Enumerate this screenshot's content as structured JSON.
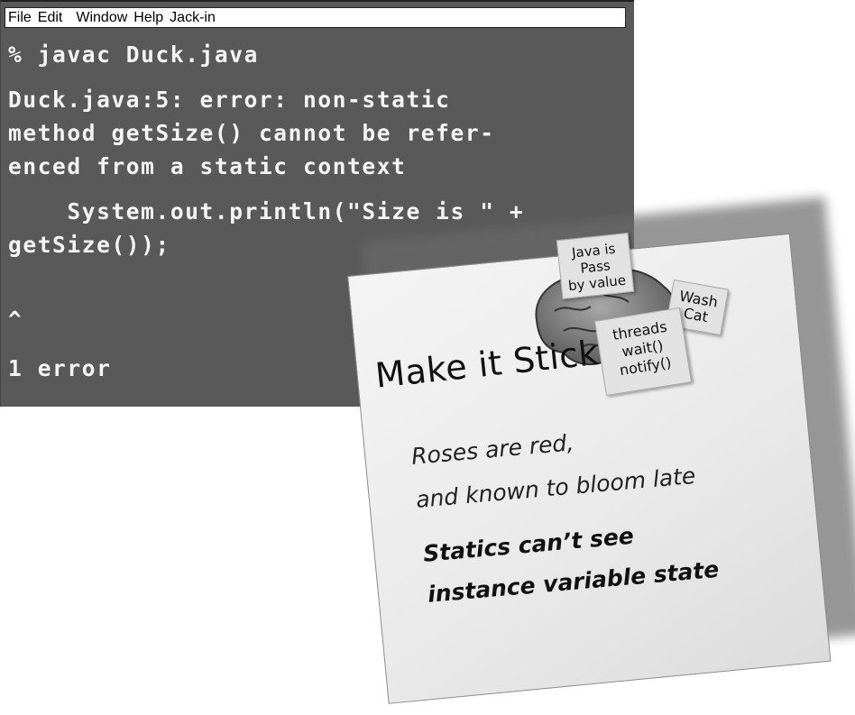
{
  "window": {
    "menu": [
      "File",
      "Edit",
      "Window",
      "Help",
      "Jack-in"
    ],
    "colors": {
      "background": "#595959",
      "text": "#f4f4f4",
      "menubar": "#ffffff"
    }
  },
  "terminal": {
    "command": "% javac Duck.java",
    "error_lines": [
      "Duck.java:5: error: non-static",
      "method getSize() cannot be refer-",
      "enced from a static context"
    ],
    "code_lines": [
      "    System.out.println(\"Size is \" +",
      "getSize());"
    ],
    "caret": "^",
    "summary": "1 error"
  },
  "sticky_note": {
    "title": "Make it Stick",
    "tags": [
      {
        "text": "Java is\nPass\nby value"
      },
      {
        "text": "Wash\nCat"
      },
      {
        "text": "threads\nwait()\nnotify()"
      }
    ],
    "lines": [
      "Roses are red,",
      "and known to bloom late",
      "Statics can’t see",
      "instance variable state"
    ],
    "icon": "brain-icon"
  }
}
